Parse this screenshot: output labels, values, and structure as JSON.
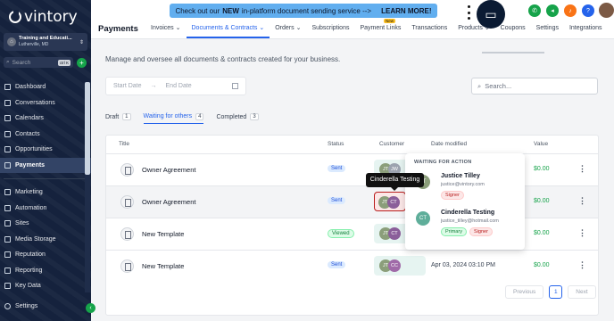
{
  "brand": {
    "name": "vintory"
  },
  "account": {
    "name": "Training and Educati...",
    "location": "Lutherville, MD"
  },
  "sidebar_search": {
    "placeholder": "Search",
    "shortcut": "ctrl K"
  },
  "sidebar": {
    "items_top": [
      {
        "label": "Dashboard",
        "icon": "dashboard-icon"
      },
      {
        "label": "Conversations",
        "icon": "chat-icon"
      },
      {
        "label": "Calendars",
        "icon": "calendar-icon"
      },
      {
        "label": "Contacts",
        "icon": "contacts-icon"
      },
      {
        "label": "Opportunities",
        "icon": "opportunities-icon"
      },
      {
        "label": "Payments",
        "icon": "payments-icon",
        "active": true
      }
    ],
    "items_bottom": [
      {
        "label": "Marketing",
        "icon": "marketing-icon"
      },
      {
        "label": "Automation",
        "icon": "automation-icon"
      },
      {
        "label": "Sites",
        "icon": "sites-icon"
      },
      {
        "label": "Media Storage",
        "icon": "media-icon"
      },
      {
        "label": "Reputation",
        "icon": "reputation-icon"
      },
      {
        "label": "Reporting",
        "icon": "reporting-icon"
      },
      {
        "label": "Key Data",
        "icon": "key-data-icon"
      }
    ],
    "settings_label": "Settings"
  },
  "banner": {
    "text_pre": "Check out our",
    "text_bold": "NEW",
    "text_post": "in-platform document sending service -->",
    "cta": "LEARN MORE!"
  },
  "header": {
    "title": "Payments",
    "new_badge": "New",
    "tabs": [
      {
        "label": "Invoices ⌄"
      },
      {
        "label": "Documents & Contracts ⌄",
        "active": true
      },
      {
        "label": "Orders ⌄"
      },
      {
        "label": "Subscriptions"
      },
      {
        "label": "Payment Links"
      },
      {
        "label": "Transactions"
      },
      {
        "label": "Products ⌄"
      },
      {
        "label": "Coupons"
      },
      {
        "label": "Settings"
      },
      {
        "label": "Integrations"
      }
    ]
  },
  "page": {
    "description": "Manage and oversee all documents & contracts created for your business.",
    "start_date": "Start Date",
    "end_date": "End Date",
    "search_placeholder": "Search..."
  },
  "doc_tabs": [
    {
      "label": "Draft",
      "count": "1"
    },
    {
      "label": "Waiting for others",
      "count": "4",
      "active": true
    },
    {
      "label": "Completed",
      "count": "3"
    }
  ],
  "table": {
    "columns": [
      "Title",
      "Status",
      "Customer",
      "Date modified",
      "Value"
    ],
    "rows": [
      {
        "title": "Owner Agreement",
        "status": "Sent",
        "date": "",
        "value": "$0.00",
        "avatars": [
          "JT",
          "JW"
        ]
      },
      {
        "title": "Owner Agreement",
        "status": "Sent",
        "date": "",
        "value": "$0.00",
        "avatars": [
          "JT",
          "CT"
        ]
      },
      {
        "title": "New Template",
        "status": "Viewed",
        "date": "",
        "value": "$0.00",
        "avatars": [
          "JT",
          "CT"
        ]
      },
      {
        "title": "New Template",
        "status": "Sent",
        "date": "Apr 03, 2024 03:10 PM",
        "value": "$0.00",
        "avatars": [
          "JT",
          "CC"
        ]
      }
    ]
  },
  "pagination": {
    "prev": "Previous",
    "page": "1",
    "next": "Next"
  },
  "tooltip": {
    "text": "Cinderella Testing"
  },
  "popover": {
    "heading": "WAITING FOR ACTION",
    "users": [
      {
        "initials": "JT",
        "name": "Justice Tilley",
        "email": "justice@vintory.com",
        "chips": [
          "Signer"
        ]
      },
      {
        "initials": "CT",
        "name": "Cinderella Testing",
        "email": "justice_tilley@hotmail.com",
        "chips": [
          "Primary",
          "Signer"
        ]
      }
    ]
  },
  "colors": {
    "sidebar_bg": "#15223d",
    "accent": "#2563eb",
    "success": "#16a34a",
    "banner": "#61aeef"
  }
}
